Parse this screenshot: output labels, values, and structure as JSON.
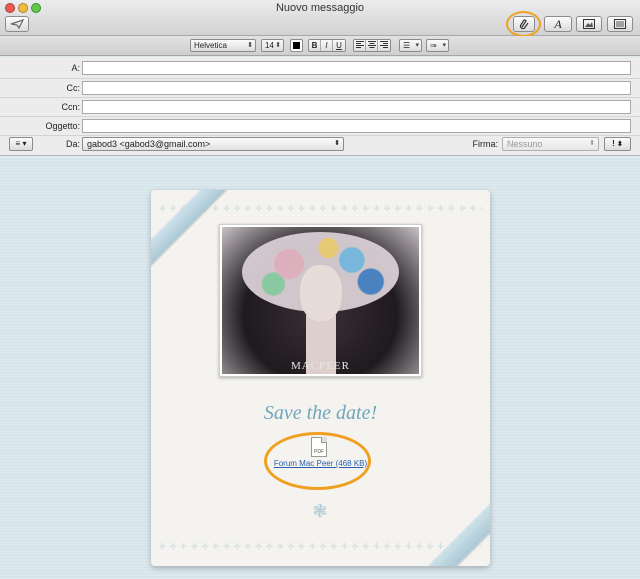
{
  "window": {
    "title": "Nuovo messaggio"
  },
  "toolbar": {
    "send_icon": "paper-plane-icon",
    "attach_icon": "paperclip-icon",
    "fonts_label": "A",
    "photo_icon": "photo-browser-icon",
    "stationery_icon": "stationery-icon"
  },
  "format": {
    "font_name": "Helvetica",
    "font_size": "14",
    "bold": "B",
    "italic": "I",
    "underline": "U",
    "list_label": "☰",
    "indent_label": "⇒"
  },
  "headers": {
    "to_label": "A:",
    "cc_label": "Cc:",
    "bcc_label": "Ccn:",
    "subject_label": "Oggetto:",
    "to_value": "",
    "cc_value": "",
    "bcc_value": "",
    "subject_value": "",
    "from_label": "Da:",
    "from_value": "gabod3 <gabod3@gmail.com>",
    "signature_label": "Firma:",
    "signature_value": "Nessuno",
    "priority_label": "!"
  },
  "body": {
    "photo_caption": "MACPEER",
    "headline": "Save the date!",
    "attachment_type": "PDF",
    "attachment_link": "Forum Mac Peer (468 KB)"
  },
  "colors": {
    "highlight": "#f0a020",
    "headline": "#6fa6ba",
    "link": "#2a5fb0"
  }
}
